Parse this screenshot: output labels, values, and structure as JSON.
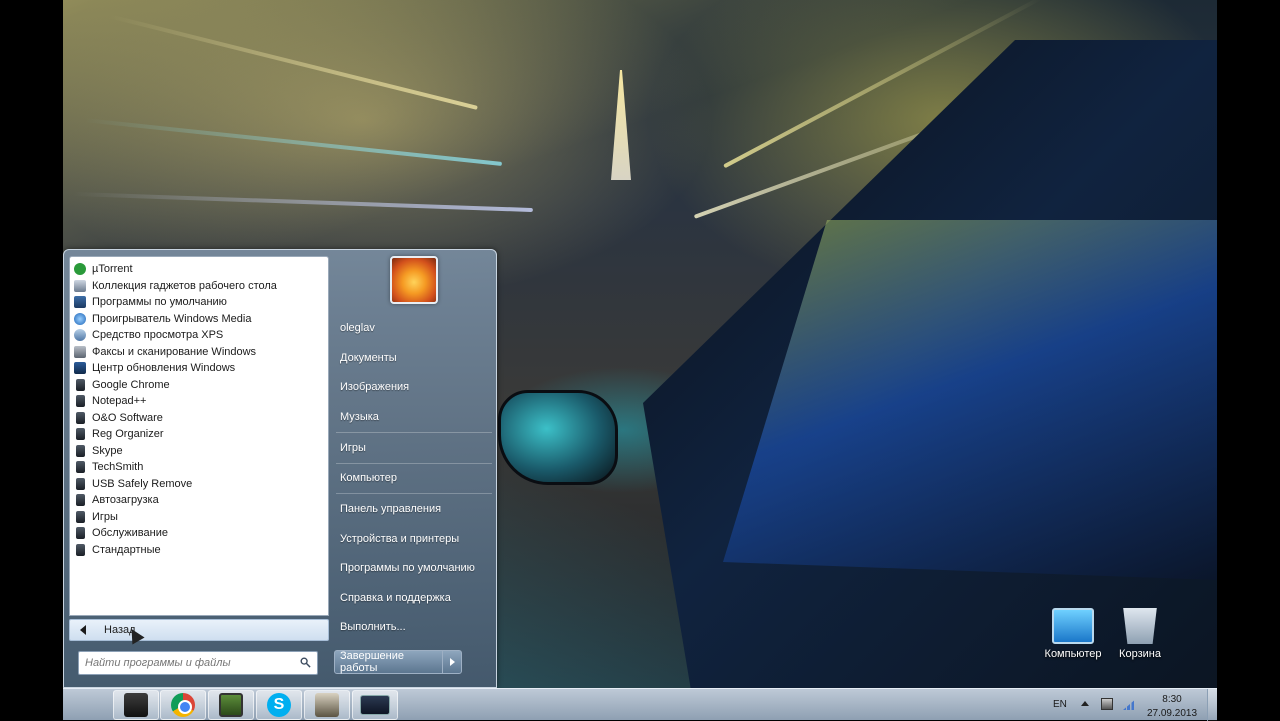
{
  "start_menu": {
    "programs": [
      {
        "label": "µTorrent",
        "icon": "utorrent-icon"
      },
      {
        "label": "Коллекция гаджетов рабочего стола",
        "icon": "gadget-icon"
      },
      {
        "label": "Программы по умолчанию",
        "icon": "default-programs-icon"
      },
      {
        "label": "Проигрыватель Windows Media",
        "icon": "media-player-icon"
      },
      {
        "label": "Средство просмотра XPS",
        "icon": "xps-viewer-icon"
      },
      {
        "label": "Факсы и сканирование Windows",
        "icon": "fax-icon"
      },
      {
        "label": "Центр обновления Windows",
        "icon": "windows-update-icon"
      },
      {
        "label": "Google Chrome",
        "icon": "folder-icon"
      },
      {
        "label": "Notepad++",
        "icon": "folder-icon"
      },
      {
        "label": "O&O Software",
        "icon": "folder-icon"
      },
      {
        "label": "Reg Organizer",
        "icon": "folder-icon"
      },
      {
        "label": "Skype",
        "icon": "folder-icon"
      },
      {
        "label": "TechSmith",
        "icon": "folder-icon"
      },
      {
        "label": "USB Safely Remove",
        "icon": "folder-icon"
      },
      {
        "label": "Автозагрузка",
        "icon": "folder-icon"
      },
      {
        "label": "Игры",
        "icon": "folder-icon"
      },
      {
        "label": "Обслуживание",
        "icon": "folder-icon"
      },
      {
        "label": "Стандартные",
        "icon": "folder-icon"
      }
    ],
    "back_label": "Назад",
    "search_placeholder": "Найти программы и файлы",
    "right_items": {
      "user": "oleglav",
      "documents": "Документы",
      "pictures": "Изображения",
      "music": "Музыка",
      "games": "Игры",
      "computer": "Компьютер",
      "control_panel": "Панель управления",
      "devices": "Устройства и принтеры",
      "default_programs": "Программы по умолчанию",
      "help": "Справка и поддержка",
      "run": "Выполнить..."
    },
    "shutdown_label": "Завершение работы"
  },
  "desktop_icons": {
    "computer": "Компьютер",
    "recycle_bin": "Корзина"
  },
  "taskbar": {
    "apps": [
      "file-manager-icon",
      "chrome-icon",
      "screen-recorder-icon",
      "skype-icon",
      "utility-icon",
      "control-panel-icon"
    ],
    "skype_letter": "S"
  },
  "tray": {
    "language": "EN",
    "time": "8:30",
    "date": "27.09.2013"
  }
}
